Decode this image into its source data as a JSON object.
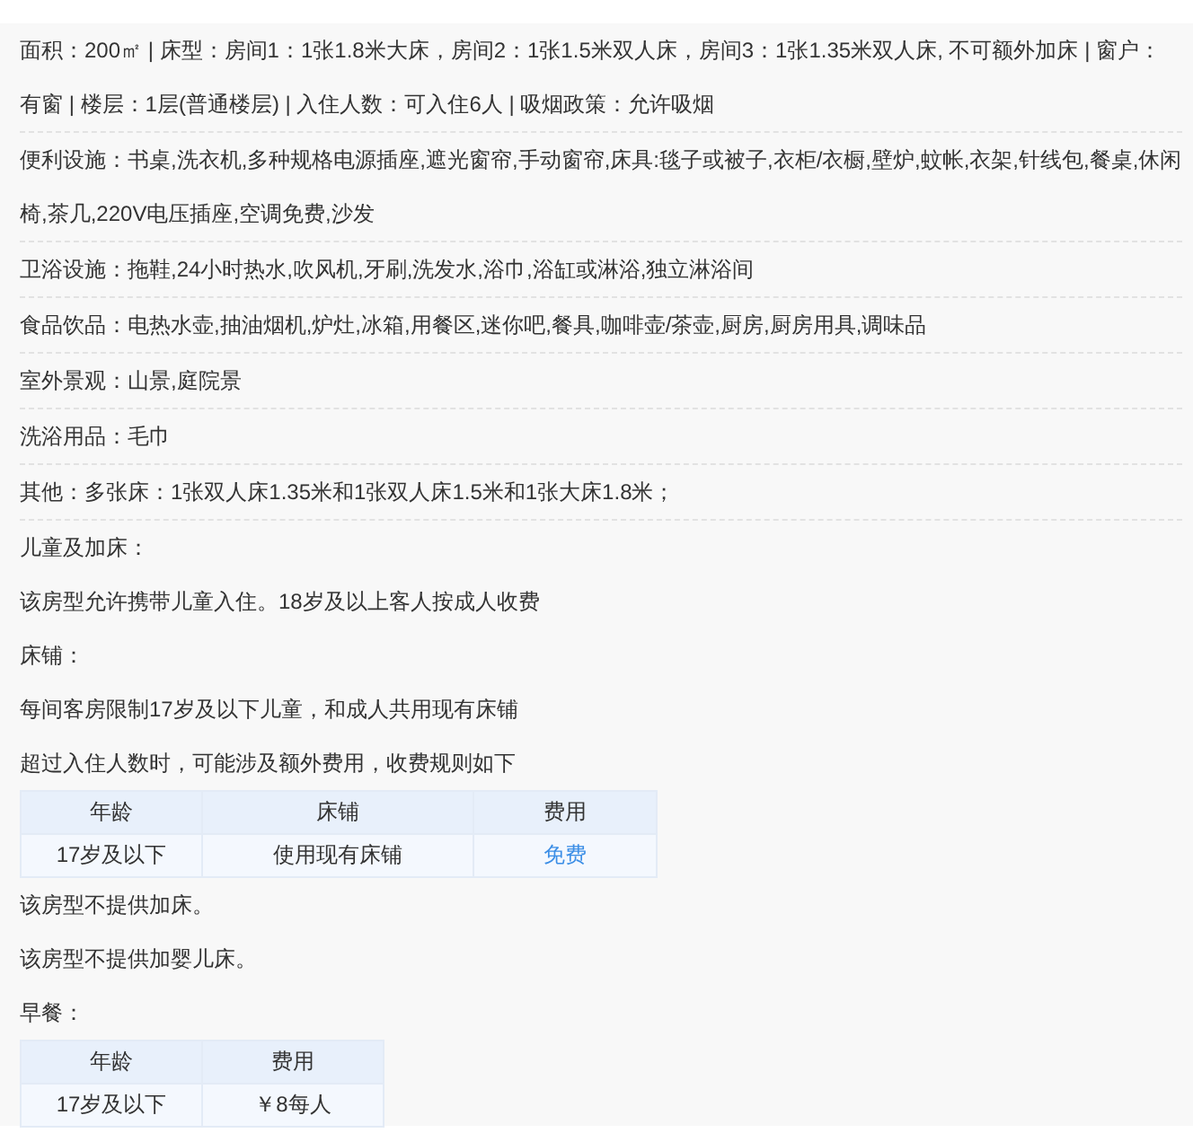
{
  "details": [
    {
      "text": "面积：200㎡ | 床型：房间1：1张1.8米大床，房间2：1张1.5米双人床，房间3：1张1.35米双人床, 不可额外加床 | 窗户：有窗 | 楼层：1层(普通楼层) | 入住人数：可入住6人 | 吸烟政策：允许吸烟"
    },
    {
      "text": "便利设施：书桌,洗衣机,多种规格电源插座,遮光窗帘,手动窗帘,床具:毯子或被子,衣柜/衣橱,壁炉,蚊帐,衣架,针线包,餐桌,休闲椅,茶几,220V电压插座,空调免费,沙发"
    },
    {
      "text": "卫浴设施：拖鞋,24小时热水,吹风机,牙刷,洗发水,浴巾,浴缸或淋浴,独立淋浴间"
    },
    {
      "text": "食品饮品：电热水壶,抽油烟机,炉灶,冰箱,用餐区,迷你吧,餐具,咖啡壶/茶壶,厨房,厨房用具,调味品"
    },
    {
      "text": "室外景观：山景,庭院景"
    },
    {
      "text": "洗浴用品：毛巾"
    },
    {
      "text": "其他：多张床：1张双人床1.35米和1张双人床1.5米和1张大床1.8米；"
    }
  ],
  "policy": [
    {
      "kind": "paragraph",
      "text": "儿童及加床："
    },
    {
      "kind": "paragraph",
      "text": "该房型允许携带儿童入住。18岁及以上客人按成人收费"
    },
    {
      "kind": "paragraph",
      "text": "床铺："
    },
    {
      "kind": "paragraph",
      "text": "每间客房限制17岁及以下儿童，和成人共用现有床铺"
    },
    {
      "kind": "paragraph",
      "text": "超过入住人数时，可能涉及额外费用，收费规则如下"
    },
    {
      "kind": "table",
      "columns": [
        "年龄",
        "床铺",
        "费用"
      ],
      "rows": [
        [
          {
            "text": "17岁及以下",
            "kind": "plain"
          },
          {
            "text": "使用现有床铺",
            "kind": "plain"
          },
          {
            "text": "免费",
            "kind": "free"
          }
        ]
      ]
    },
    {
      "kind": "paragraph",
      "text": "该房型不提供加床。"
    },
    {
      "kind": "paragraph",
      "text": "该房型不提供加婴儿床。"
    },
    {
      "kind": "paragraph",
      "text": "早餐："
    },
    {
      "kind": "table",
      "columns": [
        "年龄",
        "费用"
      ],
      "rows": [
        [
          {
            "text": "17岁及以下",
            "kind": "plain"
          },
          {
            "text": "￥8每人",
            "kind": "plain"
          }
        ]
      ]
    }
  ]
}
